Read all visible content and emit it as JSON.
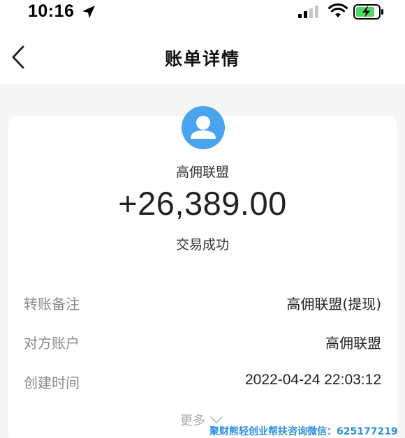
{
  "status_bar": {
    "time": "10:16"
  },
  "nav": {
    "title": "账单详情"
  },
  "transaction": {
    "payee": "高佣联盟",
    "amount": "+26,389.00",
    "status": "交易成功"
  },
  "details": [
    {
      "label": "转账备注",
      "value": "高佣联盟(提现)"
    },
    {
      "label": "对方账户",
      "value": "高佣联盟"
    },
    {
      "label": "创建时间",
      "value": "2022-04-24 22:03:12"
    }
  ],
  "more": {
    "label": "更多"
  },
  "watermark": "聚财熊轻创业帮扶咨询微信：625177219",
  "colors": {
    "accent": "#4aa3ef",
    "battery": "#4cd964",
    "watermark": "#2b8fe0"
  },
  "icons": [
    "location-arrow-icon",
    "signal-icon",
    "wifi-icon",
    "battery-charging-icon",
    "back-chevron-icon",
    "user-avatar-icon",
    "chevron-down-icon"
  ]
}
